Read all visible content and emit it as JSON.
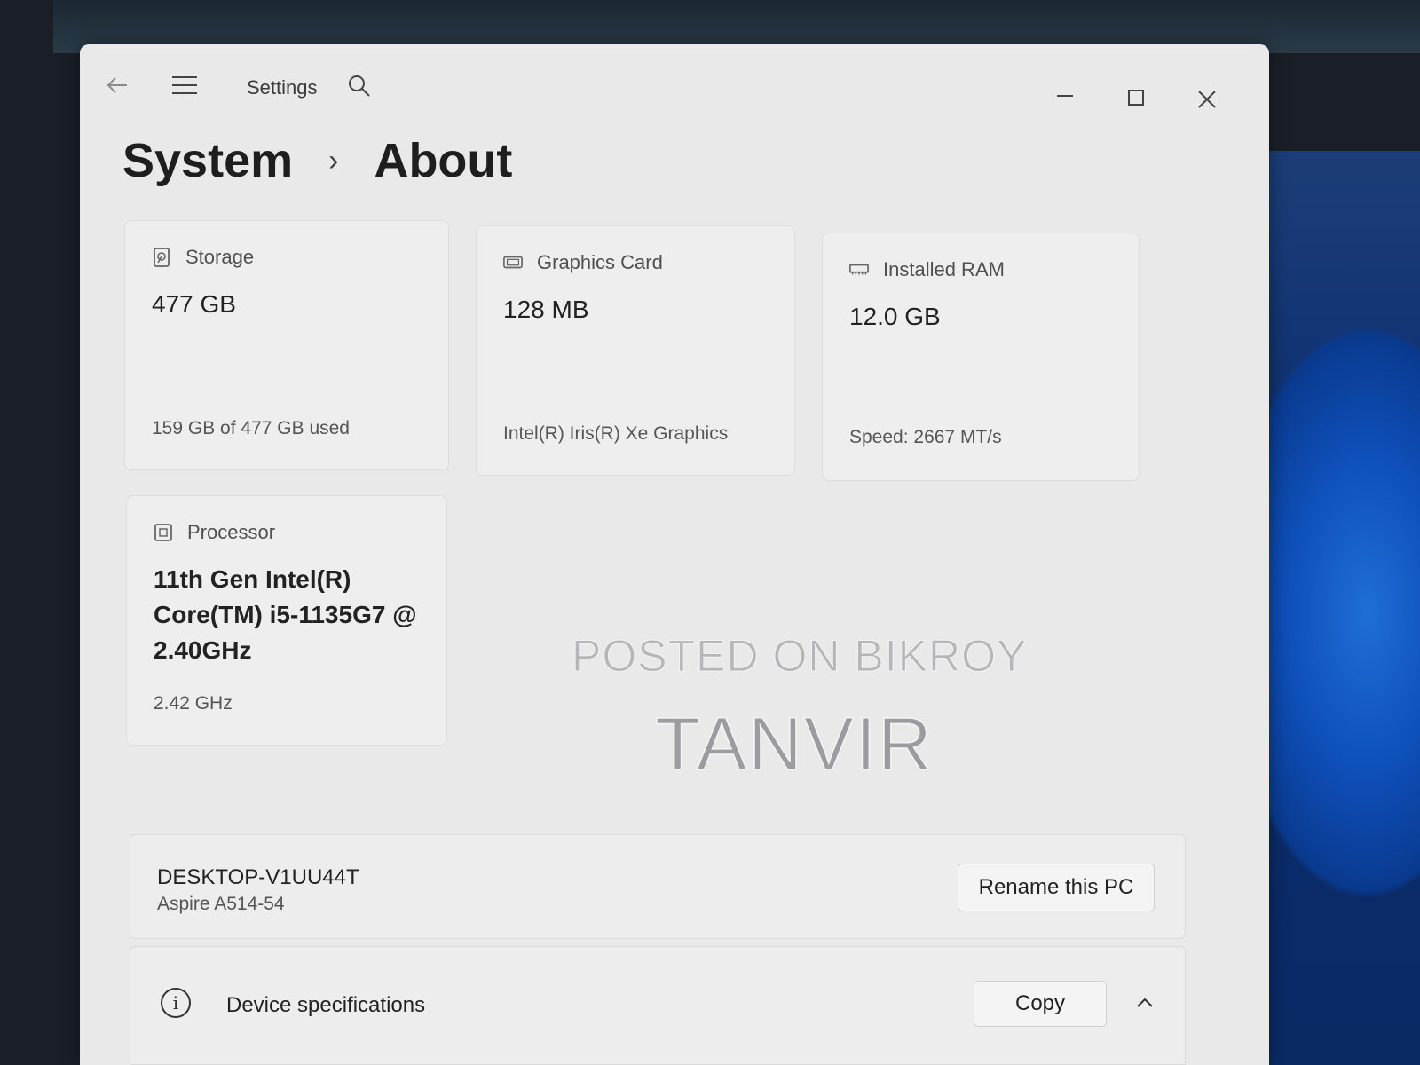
{
  "app": {
    "title": "Settings"
  },
  "breadcrumb": {
    "parent": "System",
    "separator": "›",
    "current": "About"
  },
  "cards": {
    "storage": {
      "label": "Storage",
      "value": "477 GB",
      "detail": "159 GB of 477 GB used",
      "icon": "storage-drive-icon"
    },
    "graphics": {
      "label": "Graphics Card",
      "value": "128 MB",
      "detail": "Intel(R) Iris(R) Xe Graphics",
      "icon": "graphics-card-icon"
    },
    "ram": {
      "label": "Installed RAM",
      "value": "12.0 GB",
      "detail": "Speed: 2667 MT/s",
      "icon": "memory-icon"
    },
    "processor": {
      "label": "Processor",
      "value": "11th Gen Intel(R) Core(TM) i5-1135G7 @ 2.40GHz",
      "detail": "2.42 GHz",
      "icon": "processor-chip-icon"
    }
  },
  "watermark": {
    "line1": "POSTED ON BIKROY",
    "line2": "TANVIR"
  },
  "device": {
    "name": "DESKTOP-V1UU44T",
    "model": "Aspire A514-54",
    "rename_label": "Rename this PC"
  },
  "specs": {
    "label": "Device specifications",
    "copy_label": "Copy"
  }
}
